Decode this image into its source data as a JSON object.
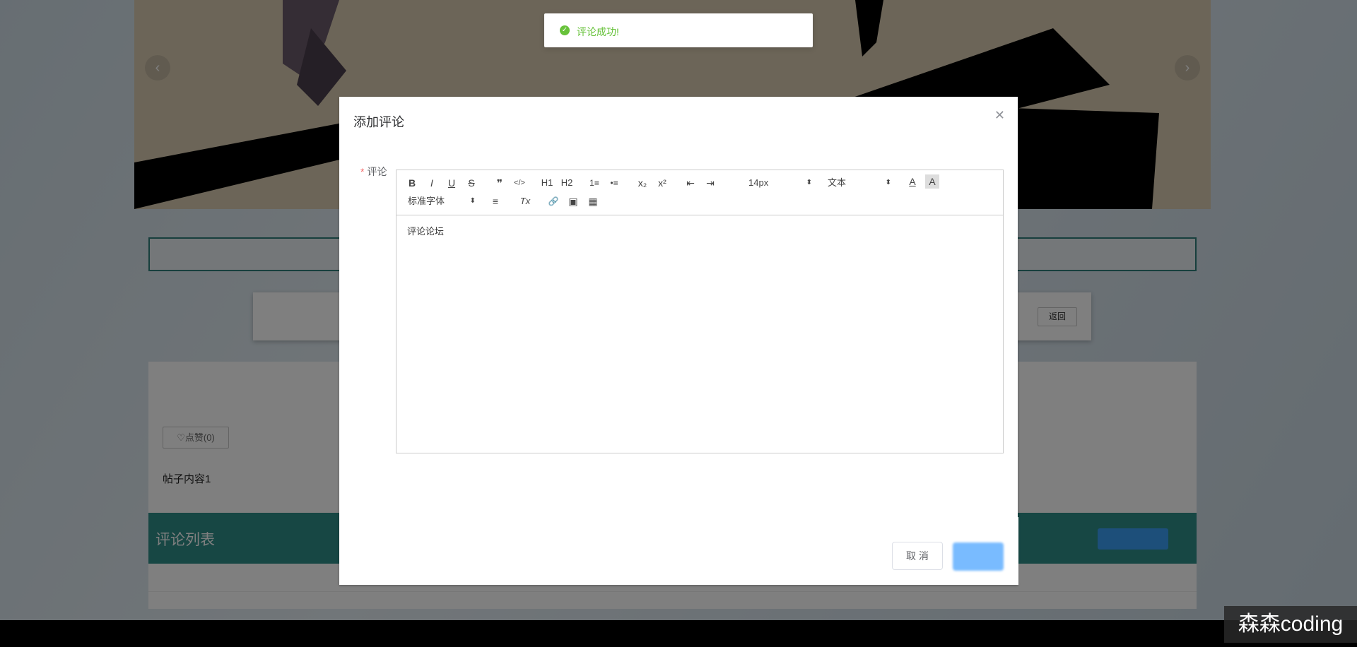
{
  "toast": {
    "message": "评论成功!",
    "status_color": "#67c23a",
    "icon": "check-circle-icon"
  },
  "page": {
    "back_label": "返回",
    "like_label": "♡点赞(0)",
    "post_content": "帖子内容1",
    "comment_list_title": "评论列表",
    "carousel_prev": "‹",
    "carousel_next": "›",
    "accent_color": "#2f8f89"
  },
  "dialog": {
    "title": "添加评论",
    "close_icon": "close-icon",
    "form_label": "评论",
    "required_mark": "*",
    "editor_content": "评论论坛",
    "cancel_label": "取 消",
    "confirm_label": ""
  },
  "toolbar": {
    "bold": "B",
    "italic": "I",
    "underline": "U",
    "strike": "S",
    "quote": "❞",
    "code": "</>",
    "h1": "H1",
    "h2": "H2",
    "ordered_list": "1≡",
    "bullet_list": "•≡",
    "subscript": "x₂",
    "superscript": "x²",
    "outdent": "⇤",
    "indent": "⇥",
    "size_select": "14px",
    "header_select": "文本",
    "color": "A",
    "background": "A",
    "font_select": "标准字体",
    "align": "≡",
    "clean": "Tx",
    "link": "🔗",
    "image": "▣",
    "video": "▦"
  },
  "watermark": "森森coding"
}
